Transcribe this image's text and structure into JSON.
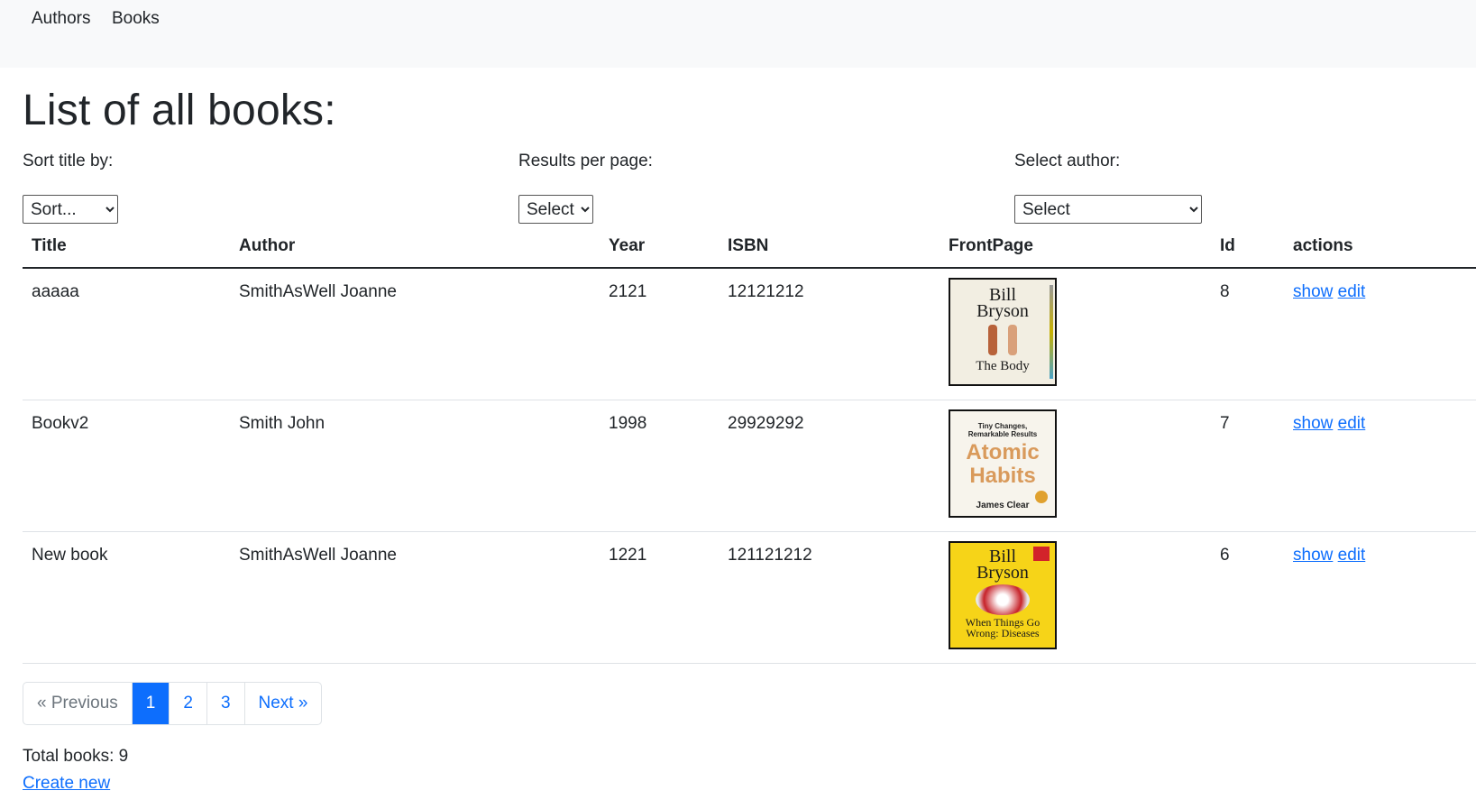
{
  "nav": {
    "authors": "Authors",
    "books": "Books"
  },
  "page_title": "List of all books:",
  "filters": {
    "sort_label": "Sort title by:",
    "sort_value": "Sort...",
    "per_page_label": "Results per page:",
    "per_page_value": "Select",
    "author_label": "Select author:",
    "author_value": "Select"
  },
  "table": {
    "headers": [
      "Title",
      "Author",
      "Year",
      "ISBN",
      "FrontPage",
      "Id",
      "actions"
    ],
    "rows": [
      {
        "title": "aaaaa",
        "author": "SmithAsWell Joanne",
        "year": "2121",
        "isbn": "12121212",
        "id": "8",
        "cover": {
          "name": "the-body-cover",
          "lines": [
            "Bill",
            "Bryson",
            "The Body"
          ],
          "bg": "#f2eee2",
          "fg": "#1b1b1b"
        }
      },
      {
        "title": "Bookv2",
        "author": "Smith John",
        "year": "1998",
        "isbn": "29929292",
        "id": "7",
        "cover": {
          "name": "atomic-habits-cover",
          "lines": [
            "Tiny Changes, Remarkable Results",
            "Atomic",
            "Habits",
            "James Clear"
          ],
          "bg": "#f7f4ec",
          "fg": "#d99a5b"
        }
      },
      {
        "title": "New book",
        "author": "SmithAsWell Joanne",
        "year": "1221",
        "isbn": "121121212",
        "id": "6",
        "cover": {
          "name": "when-things-go-wrong-cover",
          "lines": [
            "Bill",
            "Bryson",
            "When Things Go Wrong: Diseases"
          ],
          "bg": "#f6d418",
          "fg": "#1b1b1b"
        }
      }
    ],
    "action_show": "show",
    "action_edit": "edit"
  },
  "pagination": {
    "previous": "« Previous",
    "pages": [
      "1",
      "2",
      "3"
    ],
    "next": "Next »",
    "active": "1"
  },
  "total": "Total books: 9",
  "create_new": "Create new",
  "colors": {
    "link": "#0d6efd",
    "nav_bg": "#f8f9fa",
    "text": "#212529"
  }
}
